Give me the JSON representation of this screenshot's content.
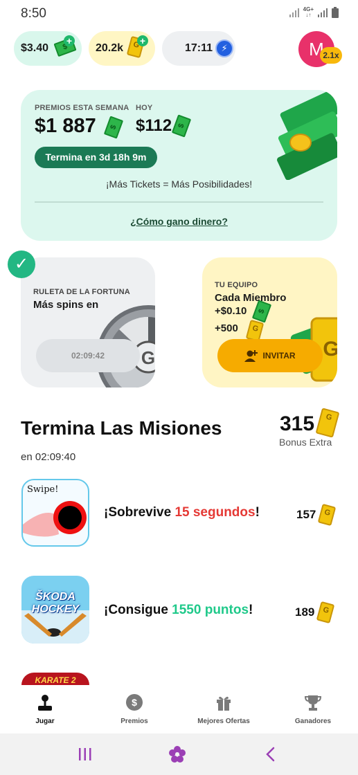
{
  "status": {
    "time": "8:50",
    "network": "4G+"
  },
  "balances": {
    "cash": "$3.40",
    "tickets": "20.2k",
    "timer": "17:11",
    "avatar_initial": "M",
    "multiplier": "2.1x"
  },
  "prize": {
    "week_label": "PREMIOS ESTA SEMANA",
    "week_amount": "$1 887",
    "today_label": "HOY",
    "today_amount": "$112",
    "ends": "Termina en 3d 18h 9m",
    "tagline": "¡Más Tickets = Más Posibilidades!",
    "how_link": "¿Cómo gano dinero?"
  },
  "wheel": {
    "label": "RULETA DE LA FORTUNA",
    "subtitle": "Más spins en",
    "timer": "02:09:42"
  },
  "team": {
    "label": "TU EQUIPO",
    "line1": "Cada Miembro",
    "cash": "+$0.10",
    "tickets": "+500",
    "invite": "INVITAR"
  },
  "missions": {
    "title": "Termina Las Misiones",
    "ends": "en 02:09:40",
    "bonus_value": "315",
    "bonus_label": "Bonus Extra",
    "items": [
      {
        "thumb_text": "Swipe!",
        "prefix": "¡Sobrevive ",
        "highlight": "15 segundos",
        "suffix": "!",
        "highlight_color": "#e53935",
        "reward": "157"
      },
      {
        "thumb_text": "ŠKODA HOCKEY",
        "prefix": "¡Consigue ",
        "highlight": "1550 puntos",
        "suffix": "!",
        "highlight_color": "#1fc98a",
        "reward": "189"
      },
      {
        "thumb_text": "KARATE 2"
      }
    ]
  },
  "nav": {
    "play": "Jugar",
    "prizes": "Premios",
    "offers": "Mejores Ofertas",
    "winners": "Ganadores"
  },
  "colors": {
    "accent_green": "#1b7a55",
    "invite_orange": "#f6ab00",
    "avatar_pink": "#e8316a"
  }
}
